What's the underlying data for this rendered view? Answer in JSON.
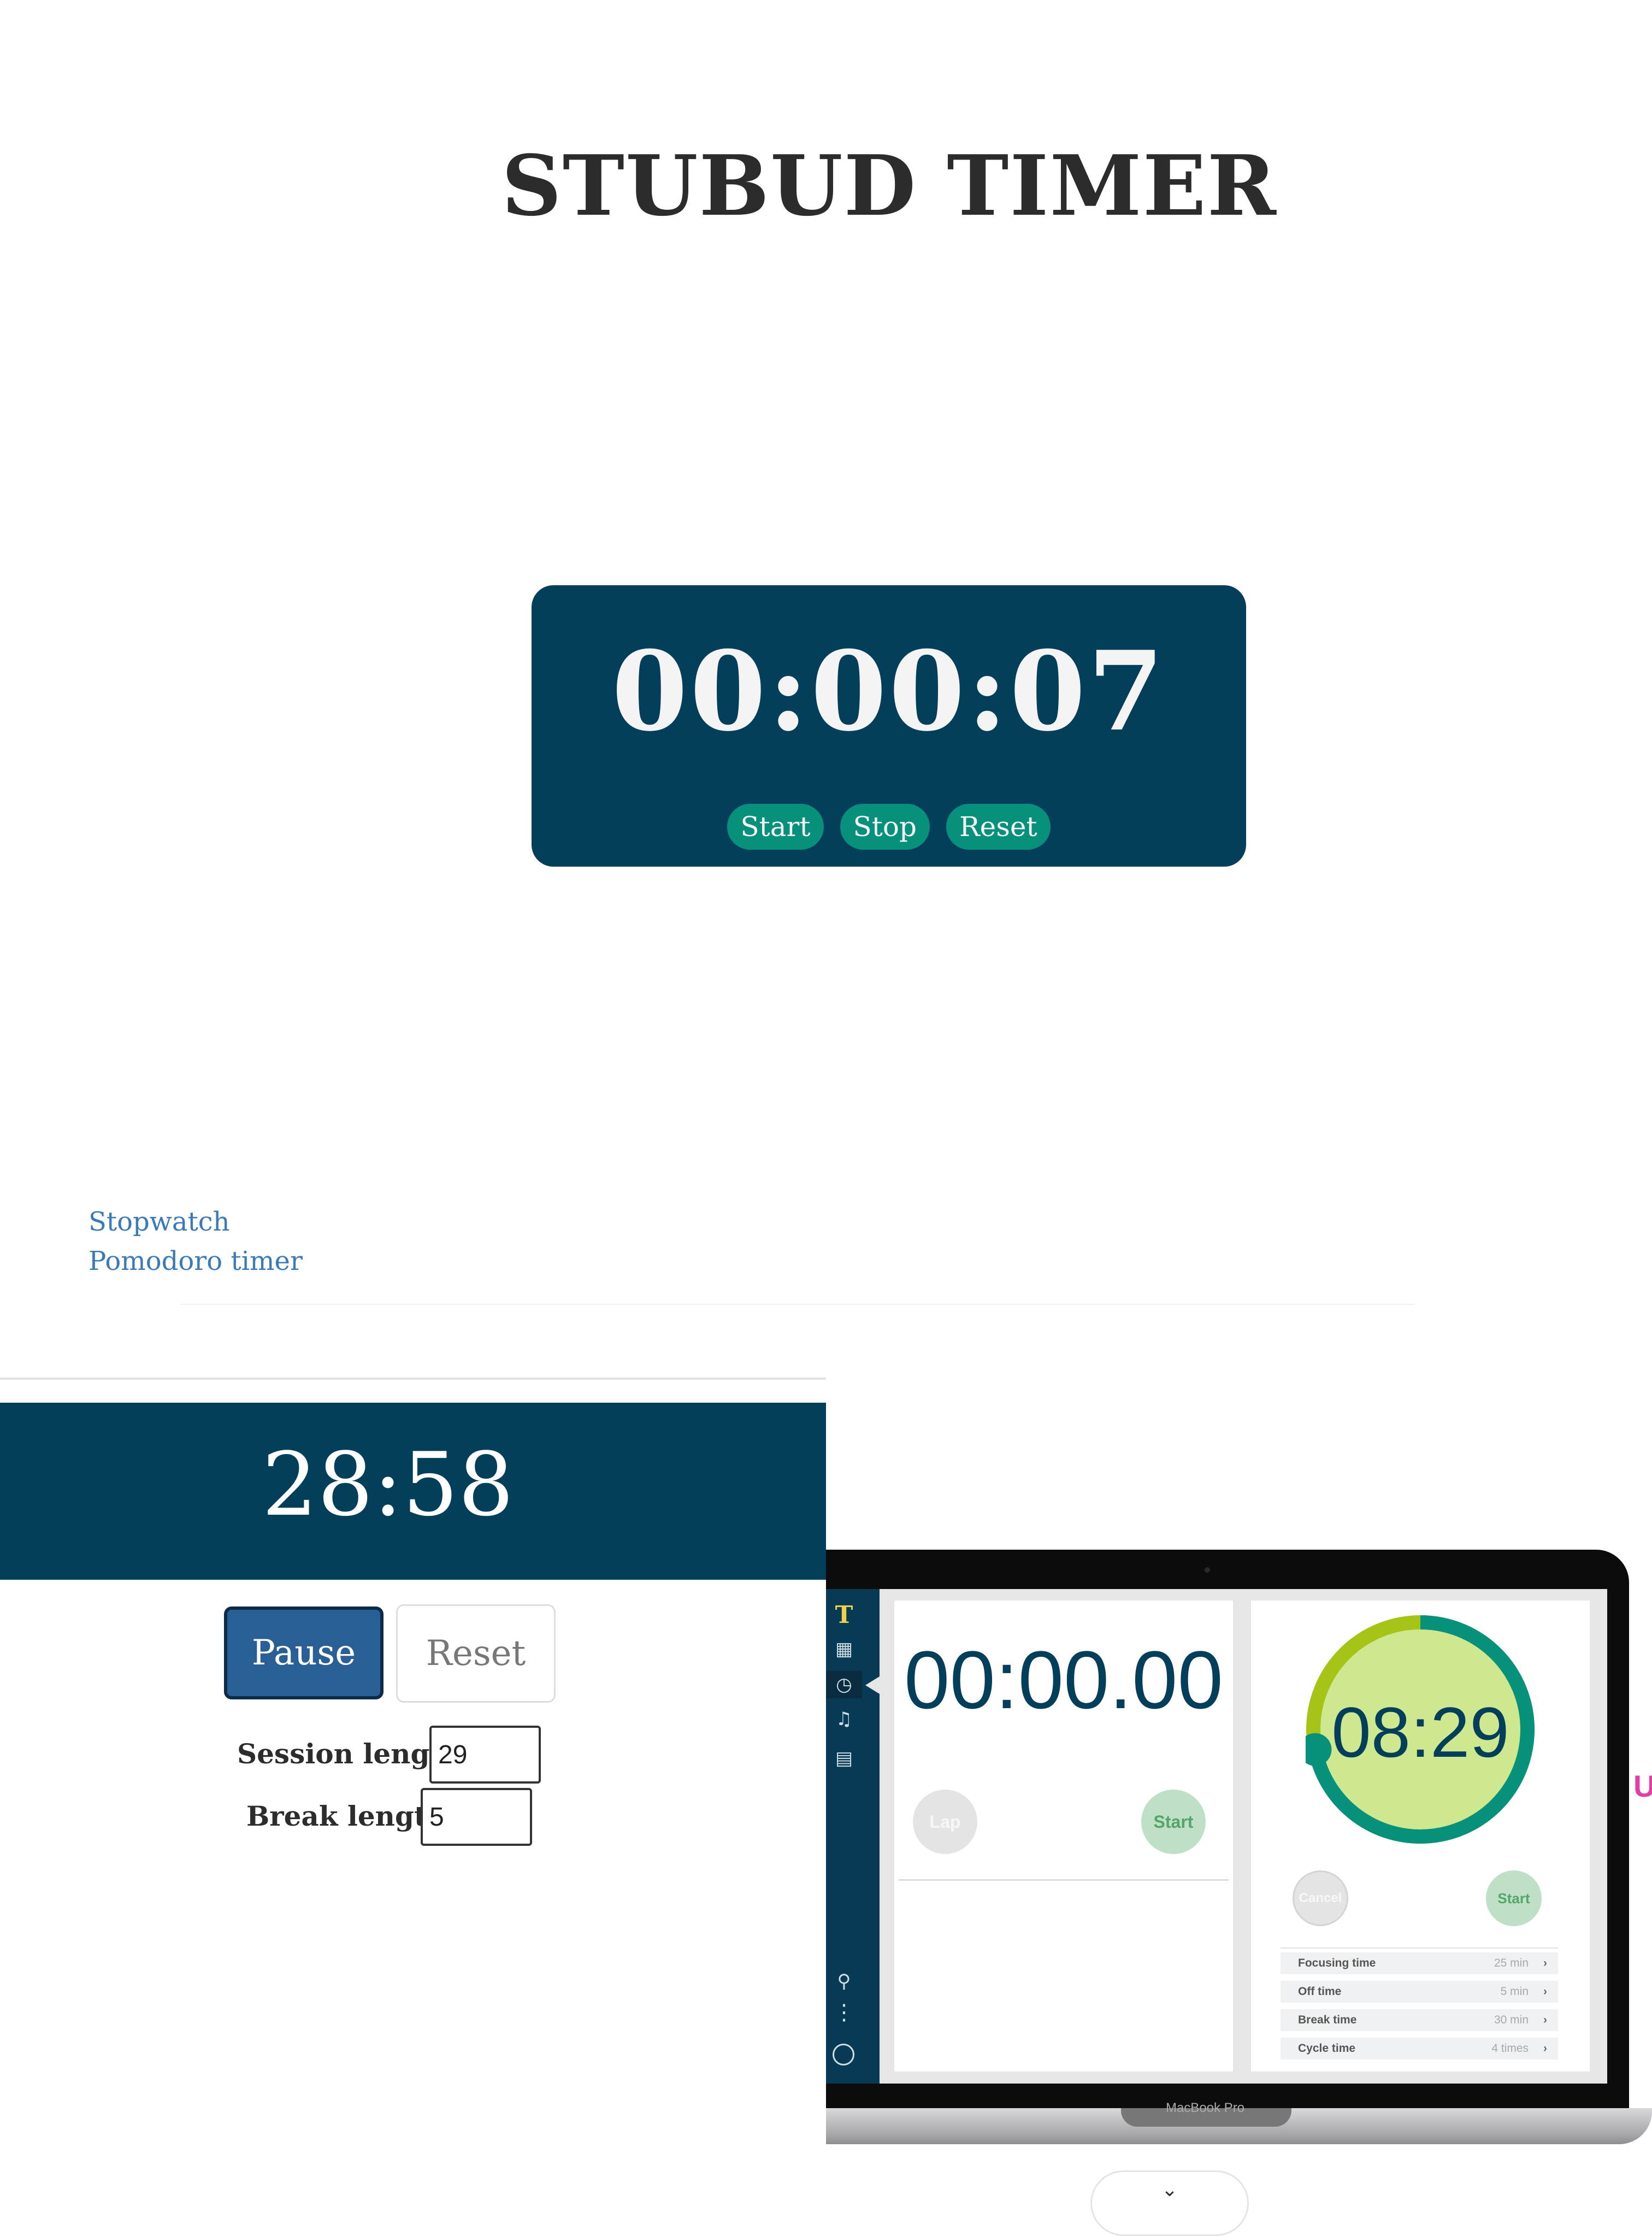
{
  "header": {
    "title": "STUBUD TIMER"
  },
  "stopwatch": {
    "time": "00:00:07",
    "start_label": "Start",
    "stop_label": "Stop",
    "reset_label": "Reset",
    "accent_color": "#033f5b",
    "button_color": "#07907b"
  },
  "nav": {
    "items": [
      "Stopwatch",
      "Pomodoro timer"
    ]
  },
  "pomodoro": {
    "time": "28:58",
    "pause_label": "Pause",
    "reset_label": "Reset",
    "session_label": "Session length:",
    "session_value": "29",
    "break_label": "Break length:",
    "break_value": "5"
  },
  "laptop": {
    "logo": "T",
    "sidebar_icons": [
      "grid-icon",
      "clock-icon",
      "music-note-icon",
      "id-card-icon",
      "search-icon",
      "more-dots-icon",
      "profile-icon"
    ],
    "stopwatch_time": "00:00.00",
    "lap_label": "Lap",
    "start_label": "Start",
    "timer_time": "08:29",
    "cancel_label": "Cancel",
    "timer_start_label": "Start",
    "timer_progress_fraction": 0.72,
    "settings": [
      {
        "label": "Focusing time",
        "value": "25 min"
      },
      {
        "label": "Off time",
        "value": "5 min"
      },
      {
        "label": "Break time",
        "value": "30 min"
      },
      {
        "label": "Cycle time",
        "value": "4 times"
      }
    ],
    "model_label": "MacBook Pro",
    "edge_glyph": "U",
    "ring_color": "#07907b",
    "ring_inner_color": "#cde88f"
  }
}
